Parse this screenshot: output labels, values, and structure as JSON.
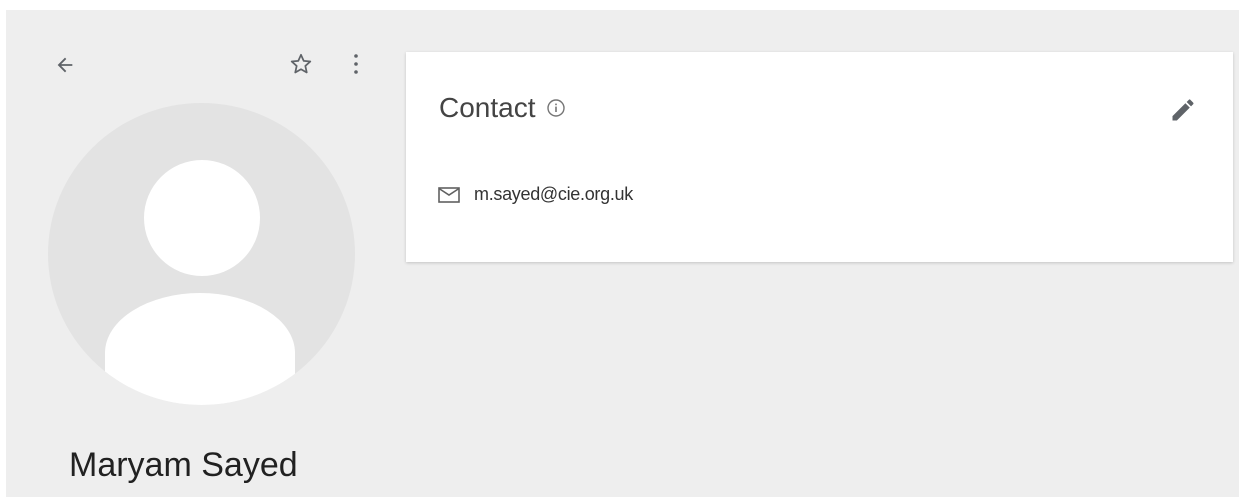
{
  "contact": {
    "name": "Maryam Sayed",
    "section_title": "Contact",
    "email": "m.sayed@cie.org.uk"
  },
  "icons": {
    "back": "arrow-back-icon",
    "star": "star-outline-icon",
    "more": "more-vert-icon",
    "info": "info-icon",
    "edit": "pencil-icon",
    "email": "mail-icon",
    "avatar": "default-person-avatar"
  },
  "colors": {
    "background": "#eeeeee",
    "card": "#ffffff",
    "avatar_bg": "#e3e3e3",
    "icon": "#5f6368"
  }
}
